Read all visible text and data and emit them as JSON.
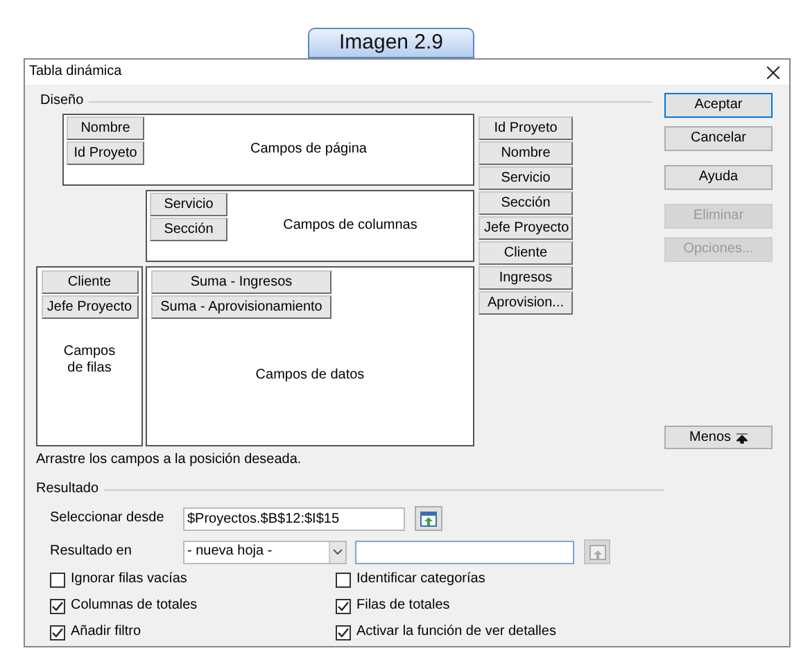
{
  "caption": "Imagen 2.9",
  "window": {
    "title": "Tabla dinámica"
  },
  "layout": {
    "label": "Diseño",
    "page_fields": {
      "label": "Campos de página",
      "fields": [
        "Nombre",
        "Id Proyeto"
      ]
    },
    "column_fields": {
      "label": "Campos de columnas",
      "fields": [
        "Servicio",
        "Sección"
      ]
    },
    "row_fields": {
      "label": "Campos de filas",
      "fields": [
        "Cliente",
        "Jefe Proyecto"
      ]
    },
    "data_fields": {
      "label": "Campos de datos",
      "fields": [
        "Suma - Ingresos",
        "Suma - Aprovisionamiento"
      ]
    },
    "available_fields": [
      "Id Proyeto",
      "Nombre",
      "Servicio",
      "Sección",
      "Jefe Proyecto",
      "Cliente",
      "Ingresos",
      "Aprovision..."
    ]
  },
  "hint": "Arrastre los campos a la posición deseada.",
  "buttons": [
    {
      "label": "Aceptar",
      "default": true,
      "disabled": false
    },
    {
      "label": "Cancelar",
      "default": false,
      "disabled": false
    },
    {
      "label": "Ayuda",
      "default": false,
      "disabled": false
    },
    {
      "label": "Eliminar",
      "default": false,
      "disabled": true
    },
    {
      "label": "Opciones...",
      "default": false,
      "disabled": true
    }
  ],
  "more_button": {
    "label": "Menos"
  },
  "result": {
    "label": "Resultado",
    "source": {
      "label": "Seleccionar desde",
      "value": "$Proyectos.$B$12:$I$15"
    },
    "destination": {
      "label": "Resultado en",
      "value": "- nueva hoja -"
    },
    "options": [
      {
        "label": "Ignorar filas vacías",
        "checked": false
      },
      {
        "label": "Identificar categorías",
        "checked": false
      },
      {
        "label": "Columnas de totales",
        "checked": true
      },
      {
        "label": "Filas de totales",
        "checked": true
      },
      {
        "label": "Añadir filtro",
        "checked": true
      },
      {
        "label": "Activar la función de ver detalles",
        "checked": true
      }
    ]
  }
}
